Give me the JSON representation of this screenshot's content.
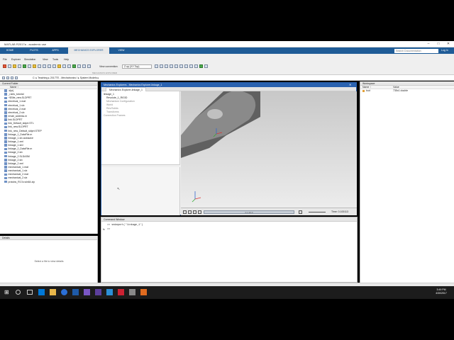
{
  "window": {
    "title": "MATLAB R2017a - academic use",
    "buttons": [
      "–",
      "□",
      "✕"
    ]
  },
  "tabs": [
    {
      "label": "HOME",
      "active": false
    },
    {
      "label": "PLOTS",
      "active": false
    },
    {
      "label": "APPS",
      "active": false
    },
    {
      "label": "MECHANICS EXPLORER",
      "active": true
    },
    {
      "label": "VIEW",
      "active": false
    }
  ],
  "search": {
    "placeholder": "Search Documentation"
  },
  "login": "Log In",
  "ribbon": {
    "menu": [
      "File",
      "Explorer",
      "Simulation",
      "View",
      "Tools",
      "Help"
    ],
    "view_convention_label": "View convention:",
    "view_convention_value": "Z up (XY Top)",
    "caption": "MECHANICS EXPLORER"
  },
  "address": {
    "path": [
      "C:",
      "Teaching",
      "2017TE - Mechatronics I",
      "System Models"
    ]
  },
  "current_folder": {
    "header": "Current Folder",
    "column": "Name ↑",
    "files": [
      ".slprj",
      "_rules_tutorial",
      "~$Site_new.SLDPRT",
      "electrical_1.mat",
      "electrical_1.slx",
      "electrical_2.mat",
      "electrical_2.slx",
      "email_address.m",
      "link.SLDPRT",
      "link_Default_sldprt.STL",
      "link_new.SLDPRT",
      "link_new_Default_sldprt.STEP",
      "linkage_1_DataFile.m",
      "linkage_1.slx.autosave",
      "linkage_1.xml",
      "linkage_1.slxl",
      "linkage_2_DataFile.m",
      "linkage_2.slx",
      "linkage_2.SLDASM",
      "linkage_2.slx",
      "linkage_2.xml",
      "mechanical_1.mat",
      "mechanical_1.slx",
      "mechanical_2.mat",
      "mechanical_2.slx",
      "protobs_R17a.win64.zip"
    ]
  },
  "details": {
    "header": "Details",
    "message": "Select a file to view details"
  },
  "mechanics_explorer": {
    "title": "Mechanics Explorers - Mechanics Explorer-linkage_1",
    "tab": "Mechanics Explorer-linkage_1",
    "tree": [
      "linkage_1",
      "Revolute_1_RIGID",
      "Mechanism Configuration",
      "World",
      "Rev/Solids",
      "Transforms",
      "Connection Frames"
    ],
    "time_label": "Time: 0.100113",
    "progress_label": "0.1:10.0"
  },
  "command_window": {
    "header": "Command Window",
    "lines": [
      ">> smimport('linkage_1')",
      ">>"
    ]
  },
  "workspace": {
    "header": "Workspace",
    "columns": [
      "Name ↑",
      "Value"
    ],
    "rows": [
      {
        "name": "tout",
        "value": "735x1 double"
      }
    ]
  },
  "taskbar": {
    "time": "3:49 PM",
    "date": "4/30/2017"
  }
}
